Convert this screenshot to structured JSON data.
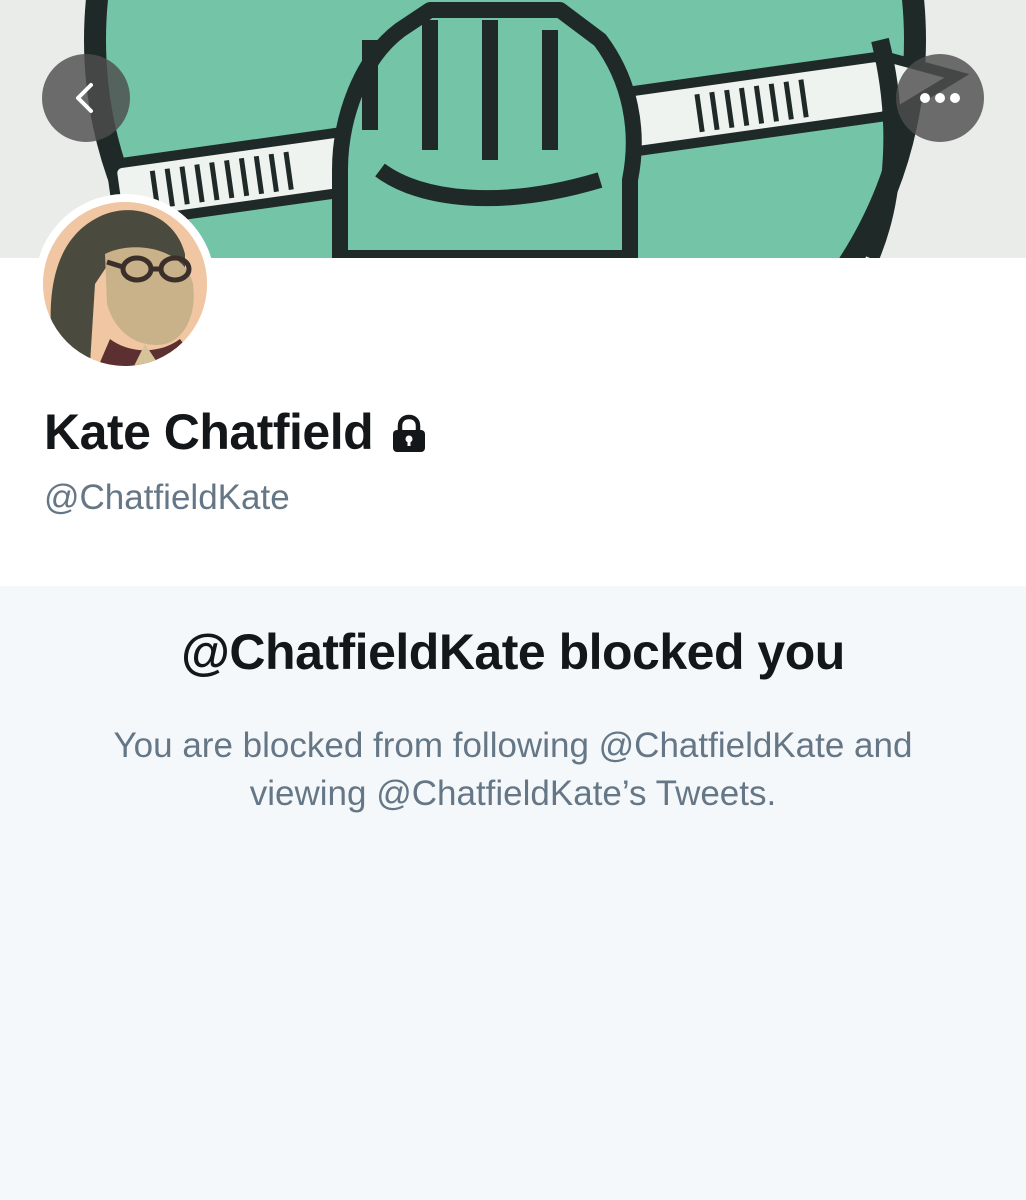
{
  "profile": {
    "display_name": "Kate Chatfield",
    "handle": "@ChatfieldKate",
    "protected_icon": "lock-icon"
  },
  "header": {
    "back_icon": "chevron-left-icon",
    "more_icon": "more-horizontal-icon"
  },
  "blocked": {
    "title": "@ChatfieldKate blocked you",
    "line1": "You are blocked from following @ChatfieldKate and",
    "line2": "viewing @ChatfieldKate’s Tweets."
  },
  "colors": {
    "background": "#f5f8fa",
    "primary_text": "#14171a",
    "secondary_text": "#657786",
    "banner_green": "#74c4a8",
    "banner_ink": "#1f2a28"
  }
}
